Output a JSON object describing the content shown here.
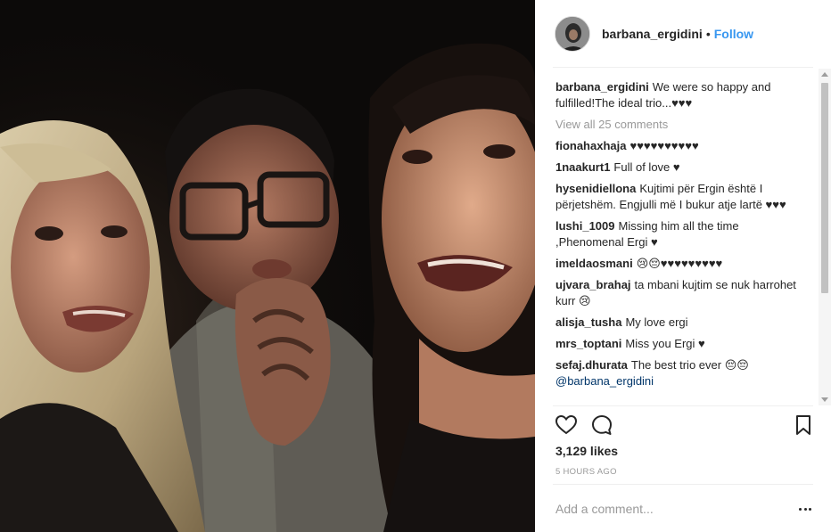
{
  "post": {
    "author": "barbana_ergidini",
    "separator": "•",
    "follow_label": "Follow",
    "caption": {
      "user": "barbana_ergidini",
      "text": "We were so happy and fulfilled!The ideal trio...♥♥♥"
    },
    "view_all_label": "View all 25 comments",
    "comments": [
      {
        "user": "fionahaxhaja",
        "text": "♥♥♥♥♥♥♥♥♥♥"
      },
      {
        "user": "1naakurt1",
        "text": "Full of love ♥"
      },
      {
        "user": "hysenidiellona",
        "text": "Kujtimi për Ergin është I përjetshëm. Engjulli më I bukur atje lartë ♥♥♥"
      },
      {
        "user": "lushi_1009",
        "text": "Missing him all the time ,Phenomenal Ergi ♥"
      },
      {
        "user": "imeldaosmani",
        "text": "😢😔♥♥♥♥♥♥♥♥♥"
      },
      {
        "user": "ujvara_brahaj",
        "text": "ta mbani kujtim se nuk harrohet kurr 😢"
      },
      {
        "user": "alisja_tusha",
        "text": "My love ergi"
      },
      {
        "user": "mrs_toptani",
        "text": "Miss you Ergi ♥"
      },
      {
        "user": "sefaj.dhurata",
        "text": "The best trio ever 😔😔"
      }
    ],
    "trailing_mention": "@barbana_ergidini",
    "likes": "3,129 likes",
    "time_ago": "5 HOURS AGO",
    "add_comment_placeholder": "Add a comment..."
  },
  "icons": {
    "like": "heart-icon",
    "comment": "comment-bubble-icon",
    "save": "bookmark-icon",
    "more": "more-options-icon"
  },
  "colors": {
    "follow": "#3897f0",
    "text": "#262626",
    "muted": "#999999",
    "divider": "#efefef",
    "photo_bg": "#0c0a09"
  }
}
